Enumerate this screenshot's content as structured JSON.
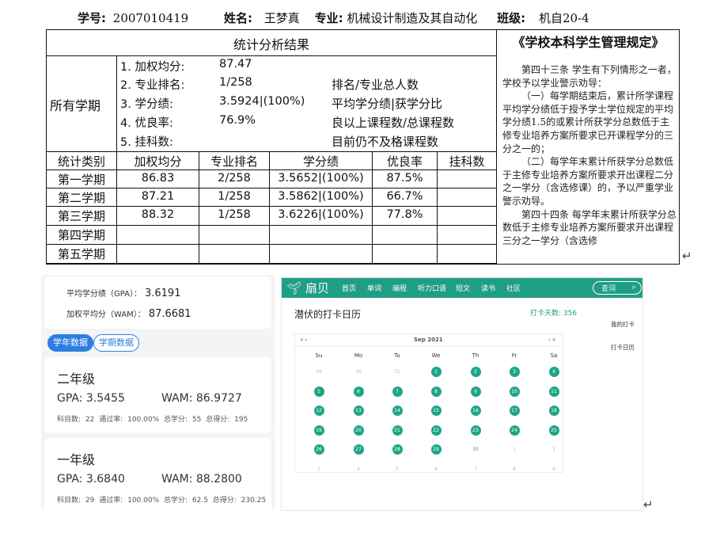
{
  "header": {
    "student_id_label": "学号:",
    "student_id": "2007010419",
    "name_label": "姓名:",
    "name": "王梦真",
    "major_label": "专业:",
    "major": "机械设计制造及其自动化",
    "class_label": "班级:",
    "class": "机自20-4"
  },
  "summary": {
    "title": "统计分析结果",
    "row_label": "所有学期",
    "items": [
      {
        "label": "1. 加权均分:",
        "value": "87.47",
        "note": ""
      },
      {
        "label": "2. 专业排名:",
        "value": "1/258",
        "note": "排名/专业总人数"
      },
      {
        "label": "3. 学分绩:",
        "value": "3.5924|(100%)",
        "note": "平均学分绩|获学分比"
      },
      {
        "label": "4. 优良率:",
        "value": "76.9%",
        "note": "良以上课程数/总课程数"
      },
      {
        "label": "5. 挂科数:",
        "value": "",
        "note": "目前仍不及格课程数"
      }
    ]
  },
  "terms": {
    "headers": [
      "统计类别",
      "加权均分",
      "专业排名",
      "学分绩",
      "优良率",
      "挂科数"
    ],
    "rows": [
      [
        "第一学期",
        "86.83",
        "2/258",
        "3.5652|(100%)",
        "87.5%",
        ""
      ],
      [
        "第二学期",
        "87.21",
        "1/258",
        "3.5862|(100%)",
        "66.7%",
        ""
      ],
      [
        "第三学期",
        "88.32",
        "1/258",
        "3.6226|(100%)",
        "77.8%",
        ""
      ],
      [
        "第四学期",
        "",
        "",
        "",
        "",
        ""
      ],
      [
        "第五学期",
        "",
        "",
        "",
        "",
        ""
      ]
    ]
  },
  "regulation": {
    "title": "《学校本科学生管理规定》",
    "paragraphs": [
      "第四十三条 学生有下列情形之一者，学校予以学业警示劝导：",
      "（一）每学期结束后，累计所学课程平均学分绩低于授予学士学位规定的平均学分绩1.5的或累计所获学分总数低于主修专业培养方案所要求已开课程学分的三分之一的；",
      "（二）每学年末累计所获学分总数低于主修专业培养方案所要求开出课程二分之一学分（含选修课）的，予以严重学业警示劝导。",
      "第四十四条 每学年末累计所获学分总数低于主修专业培养方案所要求开出课程三分之一学分（含选修"
    ]
  },
  "return_mark": "↵",
  "gpa_app": {
    "avg_gpa_label": "平均学分绩（GPA）：",
    "avg_gpa": "3.6191",
    "avg_wam_label": "加权平均分（WAM）：",
    "avg_wam": "87.6681",
    "tab_year": "学年数据",
    "tab_term": "学期数据",
    "years": [
      {
        "title": "二年级",
        "gpa": "GPA: 3.5455",
        "wam": "WAM: 86.9727",
        "meta": "科目数: 22 通过率: 100.00% 总学分: 55 总得分: 195"
      },
      {
        "title": "一年级",
        "gpa": "GPA: 3.6840",
        "wam": "WAM: 88.2800",
        "meta": "科目数: 29 通过率: 100.00% 总学分: 62.5 总得分: 230.25"
      }
    ]
  },
  "shanbay": {
    "logo": "扇贝",
    "nav": [
      "首页",
      "单词",
      "编程",
      "听力口语",
      "短文",
      "读书",
      "社区"
    ],
    "search_placeholder": "查词",
    "title": "潜伏的打卡日历",
    "days_label": "打卡天数: 356",
    "side_links": [
      "我的打卡",
      "打卡日历"
    ],
    "calendar": {
      "nav_prev": "« ‹",
      "month": "Sep  2021",
      "nav_next": "› »",
      "weekdays": [
        "Su",
        "Mo",
        "Tu",
        "We",
        "Th",
        "Fr",
        "Sa"
      ],
      "weeks": [
        [
          [
            "29",
            "out"
          ],
          [
            "30",
            "out"
          ],
          [
            "31",
            "out"
          ],
          [
            "1",
            "chk"
          ],
          [
            "2",
            "chk"
          ],
          [
            "3",
            "chk"
          ],
          [
            "4",
            "chk"
          ]
        ],
        [
          [
            "5",
            "chk"
          ],
          [
            "6",
            "chk"
          ],
          [
            "7",
            "chk"
          ],
          [
            "8",
            "chk"
          ],
          [
            "9",
            "chk"
          ],
          [
            "10",
            "chk"
          ],
          [
            "11",
            "chk"
          ]
        ],
        [
          [
            "12",
            "chk"
          ],
          [
            "13",
            "chk"
          ],
          [
            "14",
            "chk"
          ],
          [
            "15",
            "chk"
          ],
          [
            "16",
            "chk"
          ],
          [
            "17",
            "chk"
          ],
          [
            "18",
            "chk"
          ]
        ],
        [
          [
            "19",
            "chk"
          ],
          [
            "20",
            "chk"
          ],
          [
            "21",
            "chk"
          ],
          [
            "22",
            "chk"
          ],
          [
            "23",
            "chk"
          ],
          [
            "24",
            "chk"
          ],
          [
            "25",
            "chk"
          ]
        ],
        [
          [
            "26",
            "chk"
          ],
          [
            "27",
            "chk"
          ],
          [
            "28",
            "chk"
          ],
          [
            "29",
            "chk"
          ],
          [
            "30",
            "nochk"
          ],
          [
            "1",
            "out"
          ],
          [
            "2",
            "out"
          ]
        ],
        [
          [
            "3",
            "out"
          ],
          [
            "4",
            "out"
          ],
          [
            "5",
            "out"
          ],
          [
            "6",
            "out"
          ],
          [
            "7",
            "out"
          ],
          [
            "8",
            "out"
          ],
          [
            "9",
            "out"
          ]
        ]
      ]
    },
    "colors": {
      "brand": "#209e85",
      "checked_day": "#1ea586",
      "gpa_accent": "#2f7de1"
    }
  }
}
